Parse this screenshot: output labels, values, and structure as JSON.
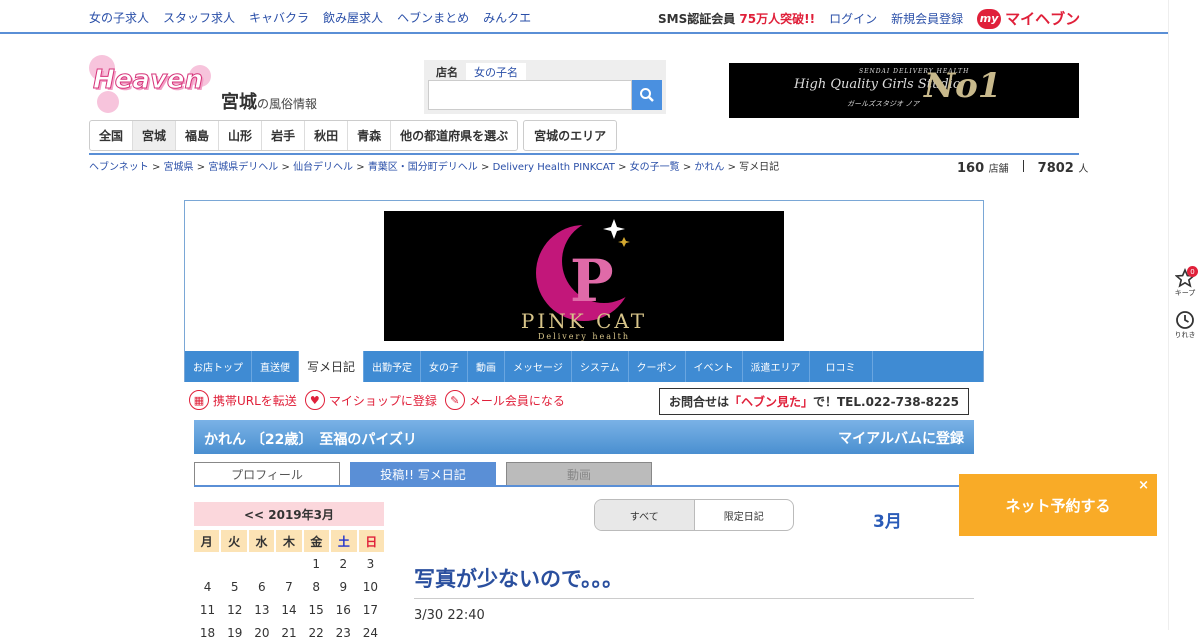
{
  "topbar": {
    "links": [
      "女の子求人",
      "スタッフ求人",
      "キャバクラ",
      "飲み屋求人",
      "ヘブンまとめ",
      "みんクエ"
    ],
    "sms_prefix": "SMS認証会員",
    "sms_highlight": "75万人突破!!",
    "login": "ログイン",
    "register": "新規会員登録",
    "my_badge": "my",
    "my_heaven": "マイヘブン"
  },
  "logo": {
    "text": "Heaven"
  },
  "region": {
    "name": "宮城",
    "suffix": "の風俗情報"
  },
  "search": {
    "tab_shop": "店名",
    "tab_girl": "女の子名",
    "placeholder": ""
  },
  "top_banner": {
    "line1": "High Quality Girls Studio",
    "line2": "No1",
    "small": "SENDAI DELIVERY HEALTH",
    "kana": "ガールズスタジオ ノア"
  },
  "pref_nav": {
    "items": [
      "全国",
      "宮城",
      "福島",
      "山形",
      "岩手",
      "秋田",
      "青森",
      "他の都道府県を選ぶ"
    ],
    "area": "宮城のエリア"
  },
  "breadcrumbs": [
    "ヘブンネット",
    "宮城県",
    "宮城県デリヘル",
    "仙台デリヘル",
    "青葉区・国分町デリヘル",
    "Delivery Health PINKCAT",
    "女の子一覧",
    "かれん",
    "写メ日記"
  ],
  "stats": {
    "shops": "160",
    "shops_unit": "店舗",
    "people": "7802",
    "people_unit": "人"
  },
  "shop": {
    "name": "PINK CAT",
    "sub": "Delivery health",
    "nav": [
      "お店トップ",
      "直送便",
      "写メ日記",
      "出勤予定",
      "女の子",
      "動画",
      "メッセージ",
      "システム",
      "クーポン",
      "イベント",
      "派遣エリア",
      "ロコミ"
    ]
  },
  "actions": {
    "url": "携帯URLを転送",
    "myshop": "マイショップに登録",
    "mail": "メール会員になる"
  },
  "contact": {
    "prefix": "お問合せは",
    "highlight": "「ヘブン見た」",
    "suffix": "で！TEL.022-738-8225"
  },
  "girl": {
    "title": "かれん 〔22歳〕　至福のパイズリ",
    "album": "マイアルバムに登録"
  },
  "tabs": {
    "profile": "プロフィール",
    "diary": "投稿!! 写メ日記",
    "video": "動画"
  },
  "calendar": {
    "header": "<< 2019年3月",
    "dow": [
      "月",
      "火",
      "水",
      "木",
      "金",
      "土",
      "日"
    ],
    "weeks": [
      [
        "",
        "",
        "",
        "",
        "1",
        "2",
        "3"
      ],
      [
        "4",
        "5",
        "6",
        "7",
        "8",
        "9",
        "10"
      ],
      [
        "11",
        "12",
        "13",
        "14",
        "15",
        "16",
        "17"
      ],
      [
        "18",
        "19",
        "20",
        "21",
        "22",
        "23",
        "24"
      ]
    ]
  },
  "filter": {
    "all": "すべて",
    "limited": "限定日記"
  },
  "month": "3月",
  "post": {
    "title": "写真が少ないので。。。",
    "date": "3/30 22:40"
  },
  "sidebar": {
    "keep_label": "キープ",
    "keep_count": "0",
    "history_label": "りれき"
  },
  "reserve": {
    "label": "ネット予約する",
    "close": "×"
  }
}
